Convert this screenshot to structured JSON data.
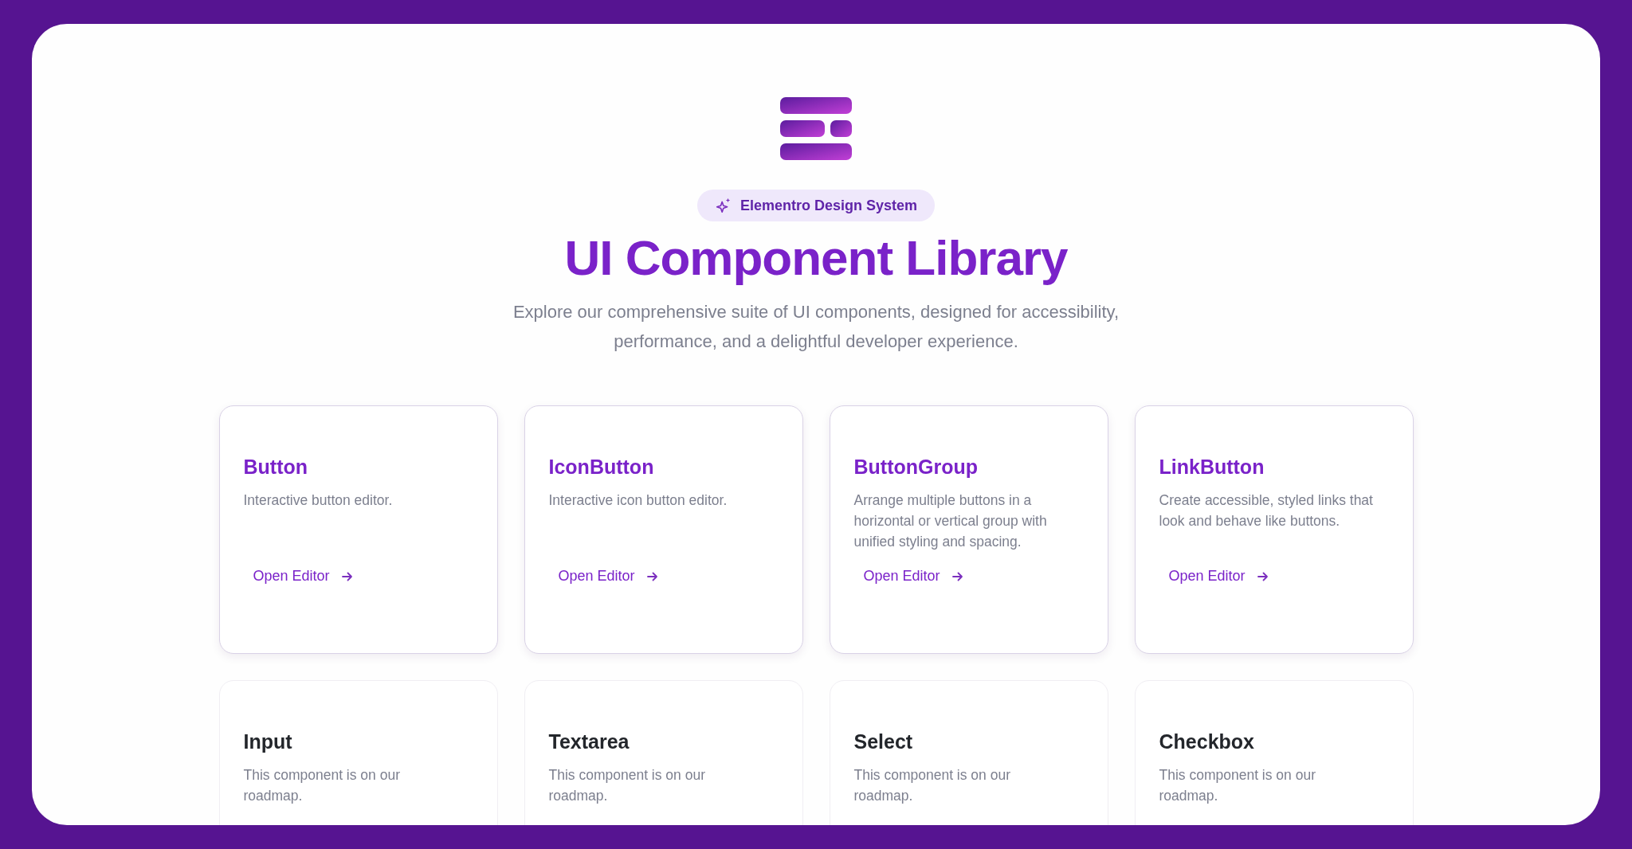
{
  "badge": {
    "label": "Elementro Design System"
  },
  "title": "UI Component Library",
  "subtitle": "Explore our comprehensive suite of UI components, designed for accessibility, performance, and a delightful developer experience.",
  "cards": [
    {
      "kind": "available",
      "title": "Button",
      "description": "Interactive button editor.",
      "link": "Open Editor"
    },
    {
      "kind": "available",
      "title": "IconButton",
      "description": "Interactive icon button editor.",
      "link": "Open Editor"
    },
    {
      "kind": "available",
      "title": "ButtonGroup",
      "description": "Arrange multiple buttons in a horizontal or vertical group with unified styling and spacing.",
      "link": "Open Editor"
    },
    {
      "kind": "available",
      "title": "LinkButton",
      "description": "Create accessible, styled links that look and behave like buttons.",
      "link": "Open Editor"
    },
    {
      "kind": "roadmap",
      "title": "Input",
      "description": "This component is on our roadmap."
    },
    {
      "kind": "roadmap",
      "title": "Textarea",
      "description": "This component is on our roadmap."
    },
    {
      "kind": "roadmap",
      "title": "Select",
      "description": "This component is on our roadmap."
    },
    {
      "kind": "roadmap",
      "title": "Checkbox",
      "description": "This component is on our roadmap."
    }
  ]
}
